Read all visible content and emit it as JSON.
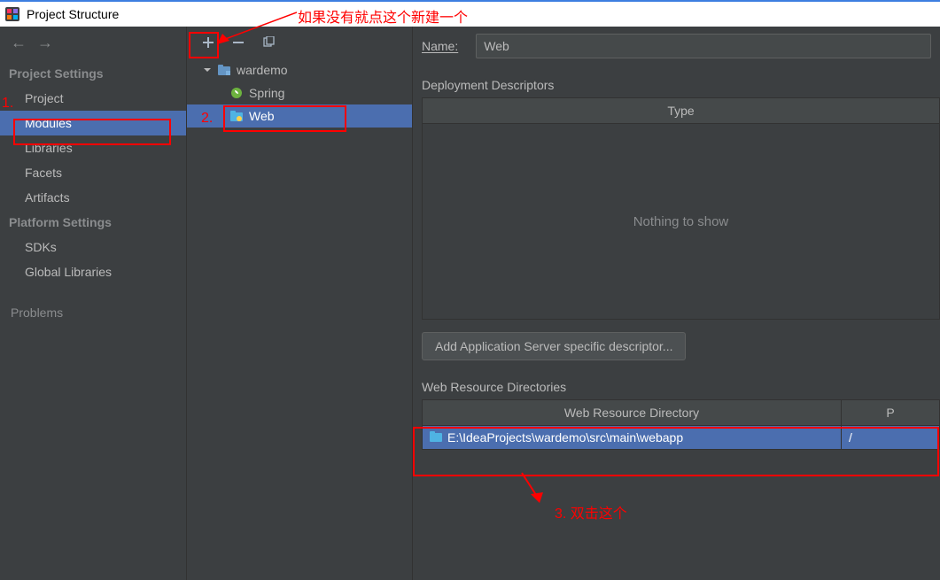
{
  "window": {
    "title": "Project Structure"
  },
  "annotations": {
    "top_note": "如果没有就点这个新建一个",
    "num1": "1.",
    "num2": "2.",
    "num3_note": "3. 双击这个"
  },
  "left": {
    "section_project": "Project Settings",
    "items_project": [
      "Project",
      "Modules",
      "Libraries",
      "Facets",
      "Artifacts"
    ],
    "section_platform": "Platform Settings",
    "items_platform": [
      "SDKs",
      "Global Libraries"
    ],
    "problems": "Problems"
  },
  "tree": {
    "root": "wardemo",
    "children": [
      "Spring",
      "Web"
    ]
  },
  "right": {
    "name_label": "Name:",
    "name_value": "Web",
    "deploy_title": "Deployment Descriptors",
    "type_header": "Type",
    "nothing": "Nothing to show",
    "add_btn": "Add Application Server specific descriptor...",
    "resource_title": "Web Resource Directories",
    "resource_header1": "Web Resource Directory",
    "resource_header2": "P",
    "resource_path": "E:\\IdeaProjects\\wardemo\\src\\main\\webapp",
    "resource_rel": "/"
  }
}
